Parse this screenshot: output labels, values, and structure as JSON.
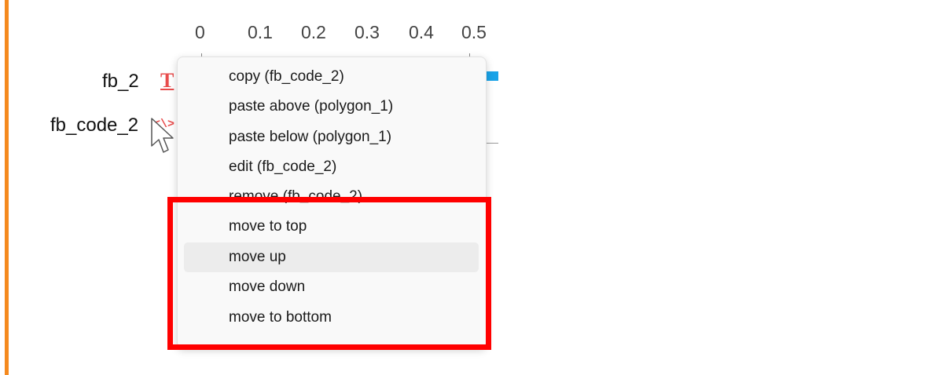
{
  "ruler": {
    "ticks": [
      "0",
      "0.1",
      "0.2",
      "0.3",
      "0.4",
      "0.5"
    ]
  },
  "rows": {
    "row1_label": "fb_2",
    "row1_icon": "T",
    "row2_label": "fb_code_2",
    "row2_icon": "<\\>"
  },
  "context_menu": {
    "items": [
      "copy (fb_code_2)",
      "paste above (polygon_1)",
      "paste below (polygon_1)",
      "edit (fb_code_2)",
      "remove (fb_code_2)",
      "move to top",
      "move up",
      "move down",
      "move to bottom"
    ],
    "hovered": "move up"
  },
  "colors": {
    "accent_bar": "#f58a1f",
    "highlight": "#ff0000",
    "icon_red": "#e84c4c",
    "blue_segment": "#1aa3e8"
  }
}
